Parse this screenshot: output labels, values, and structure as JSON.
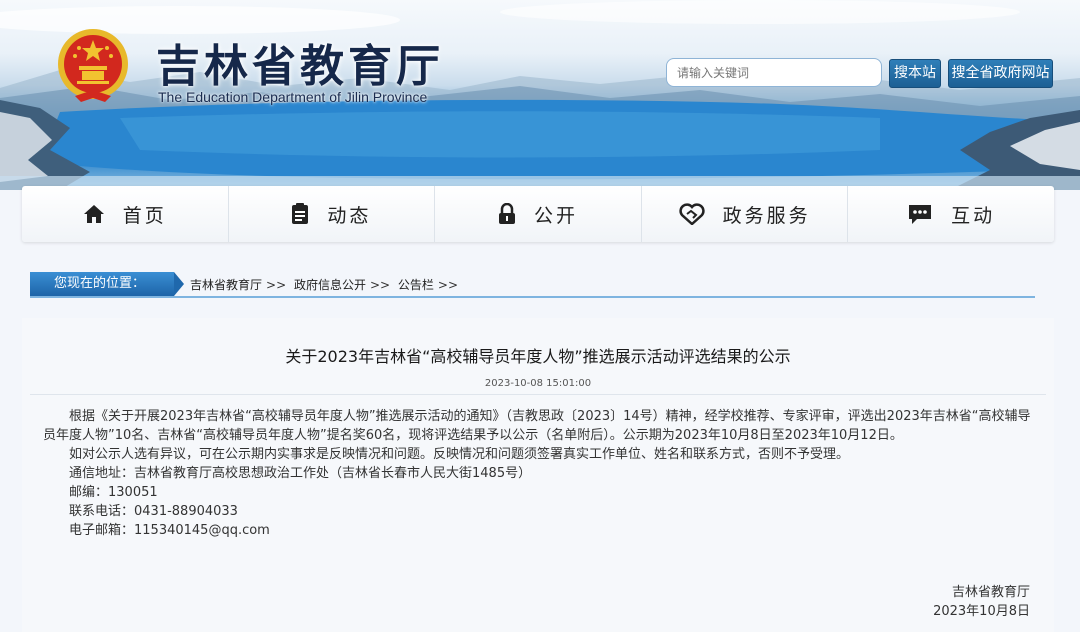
{
  "header": {
    "title": "吉林省教育厅",
    "subtitle": "The Education Department of Jilin Province",
    "search_placeholder": "请输入关键词",
    "search_site_label": "搜本站",
    "search_gov_label": "搜全省政府网站"
  },
  "nav": [
    {
      "label": "首页",
      "icon": "home-icon"
    },
    {
      "label": "动态",
      "icon": "document-icon"
    },
    {
      "label": "公开",
      "icon": "lock-icon"
    },
    {
      "label": "政务服务",
      "icon": "handshake-icon"
    },
    {
      "label": "互动",
      "icon": "chat-icon"
    }
  ],
  "breadcrumb": {
    "label": "您现在的位置：",
    "items": [
      "吉林省教育厅",
      "政府信息公开",
      "公告栏"
    ],
    "separator": ">>"
  },
  "article": {
    "title": "关于2023年吉林省“高校辅导员年度人物”推选展示活动评选结果的公示",
    "date": "2023-10-08 15:01:00",
    "para1": "根据《关于开展2023年吉林省“高校辅导员年度人物”推选展示活动的通知》（吉教思政〔2023〕14号）精神，经学校推荐、专家评审，评选出2023年吉林省“高校辅导员年度人物”10名、吉林省“高校辅导员年度人物”提名奖60名，现将评选结果予以公示（名单附后）。公示期为2023年10月8日至2023年10月12日。",
    "para2": "如对公示人选有异议，可在公示期内实事求是反映情况和问题。反映情况和问题须签署真实工作单位、姓名和联系方式，否则不予受理。",
    "address": "通信地址：吉林省教育厅高校思想政治工作处（吉林省长春市人民大街1485号）",
    "postcode": "邮编：130051",
    "phone": "联系电话：0431-88904033",
    "email": "电子邮箱：115340145@qq.com",
    "sign_org": "吉林省教育厅",
    "sign_date": "2023年10月8日"
  },
  "colors": {
    "nav_bg": "#f7f9fb",
    "button_blue": "#1f6aa5",
    "breadcrumb_blue": "#2a78c2",
    "emblem_red": "#d2281e",
    "emblem_gold": "#f2c230"
  }
}
